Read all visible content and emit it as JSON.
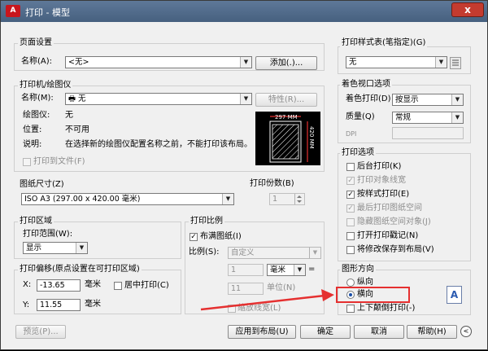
{
  "window": {
    "title": "打印 - 模型",
    "app_icon": "A",
    "close": "x"
  },
  "page_setup": {
    "group_label": "页面设置",
    "name_label": "名称(A):",
    "name_value": "<无>",
    "add_button": "添加(.)..."
  },
  "printer": {
    "group_label": "打印机/绘图仪",
    "name_label": "名称(M):",
    "name_value": "无",
    "properties_button": "特性(R)...",
    "plotter_label": "绘图仪:",
    "plotter_value": "无",
    "location_label": "位置:",
    "location_value": "不可用",
    "desc_label": "说明:",
    "desc_value": "在选择新的绘图仪配置名称之前，不能打印该布局。",
    "print_to_file": "打印到文件(F)"
  },
  "preview": {
    "width_dim": "297 MM",
    "height_dim": "420 MM"
  },
  "paper_size": {
    "group_label": "图纸尺寸(Z)",
    "value": "ISO A3 (297.00 x 420.00 毫米)"
  },
  "copies": {
    "label": "打印份数(B)",
    "value": "1"
  },
  "print_area": {
    "group_label": "打印区域",
    "range_label": "打印范围(W):",
    "range_value": "显示"
  },
  "print_offset": {
    "group_label": "打印偏移(原点设置在可打印区域)",
    "x_label": "X:",
    "x_value": "-13.65",
    "x_unit": "毫米",
    "center_label": "居中打印(C)",
    "y_label": "Y:",
    "y_value": "11.55",
    "y_unit": "毫米"
  },
  "print_scale": {
    "group_label": "打印比例",
    "fit_label": "布满图纸(I)",
    "ratio_label": "比例(S):",
    "ratio_value": "自定义",
    "value1": "1",
    "unit_value": "毫米",
    "equals": "=",
    "value2": "11",
    "unit_label": "单位(N)",
    "scale_lineweights": "缩放线宽(L)"
  },
  "plot_style": {
    "group_label": "打印样式表(笔指定)(G)",
    "value": "无"
  },
  "shaded": {
    "group_label": "着色视口选项",
    "shade_label": "着色打印(D)",
    "shade_value": "按显示",
    "quality_label": "质量(Q)",
    "quality_value": "常规",
    "dpi_label": "DPI"
  },
  "plot_options": {
    "group_label": "打印选项",
    "items": [
      {
        "label": "后台打印(K)",
        "checked": false,
        "disabled": false
      },
      {
        "label": "打印对象线宽",
        "checked": true,
        "disabled": true
      },
      {
        "label": "按样式打印(E)",
        "checked": true,
        "disabled": false
      },
      {
        "label": "最后打印图纸空间",
        "checked": true,
        "disabled": true
      },
      {
        "label": "隐藏图纸空间对象(J)",
        "checked": false,
        "disabled": true
      },
      {
        "label": "打开打印戳记(N)",
        "checked": false,
        "disabled": false
      },
      {
        "label": "将修改保存到布局(V)",
        "checked": false,
        "disabled": false
      }
    ]
  },
  "orientation": {
    "group_label": "图形方向",
    "portrait": "纵向",
    "landscape": "横向",
    "upside_down": "上下颠倒打印(-)",
    "landscape_icon": "A"
  },
  "footer": {
    "preview": "预览(P)...",
    "apply": "应用到布局(U)",
    "ok": "确定",
    "cancel": "取消",
    "help": "帮助(H)",
    "expand": "<"
  },
  "colors": {
    "highlight": "#e53030",
    "title_bar": "#4f6a8c"
  }
}
